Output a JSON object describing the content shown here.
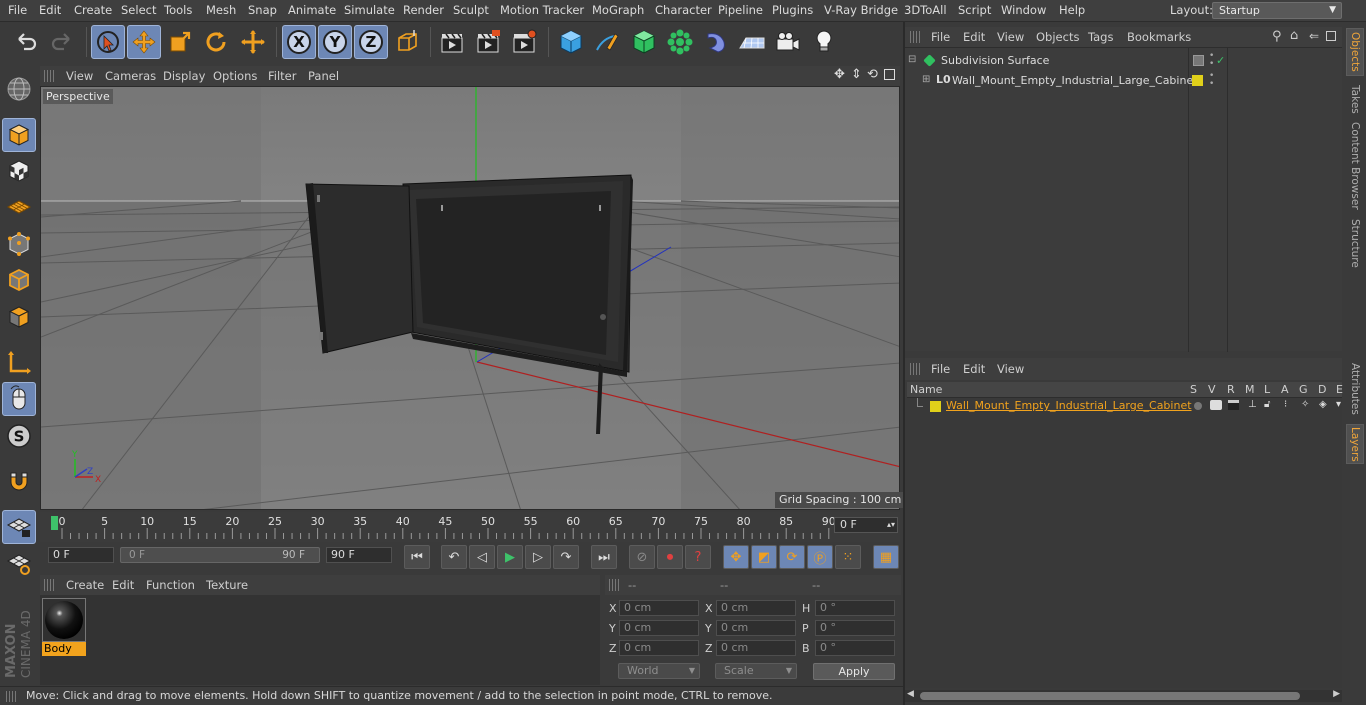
{
  "menubar": {
    "items": [
      "File",
      "Edit",
      "Create",
      "Select",
      "Tools",
      "Mesh",
      "Snap",
      "Animate",
      "Simulate",
      "Render",
      "Sculpt",
      "Motion Tracker",
      "MoGraph",
      "Character",
      "Pipeline",
      "Plugins",
      "V-Ray Bridge",
      "3DToAll",
      "Script",
      "Window",
      "Help"
    ],
    "layout_label": "Layout:",
    "layout_value": "Startup"
  },
  "viewport": {
    "menu": [
      "View",
      "Cameras",
      "Display",
      "Options",
      "Filter",
      "Panel"
    ],
    "label": "Perspective",
    "grid_spacing": "Grid Spacing : 100 cm",
    "axis_x": "X",
    "axis_y": "Y",
    "axis_z": "Z"
  },
  "timeline": {
    "ticks": [
      "0",
      "5",
      "10",
      "15",
      "20",
      "25",
      "30",
      "35",
      "40",
      "45",
      "50",
      "55",
      "60",
      "65",
      "70",
      "75",
      "80",
      "85",
      "90"
    ],
    "current_frame": "0 F"
  },
  "transport": {
    "start_field": "0 F",
    "range_start": "0 F",
    "range_end": "90 F",
    "end_field": "90 F"
  },
  "materials": {
    "menu": [
      "Create",
      "Edit",
      "Function",
      "Texture"
    ],
    "items": [
      {
        "name": "Body"
      }
    ]
  },
  "coordinates": {
    "headers": [
      "--",
      "--",
      "--"
    ],
    "rows": [
      {
        "l1": "X",
        "v1": "0 cm",
        "l2": "X",
        "v2": "0 cm",
        "l3": "H",
        "v3": "0 °"
      },
      {
        "l1": "Y",
        "v1": "0 cm",
        "l2": "Y",
        "v2": "0 cm",
        "l3": "P",
        "v3": "0 °"
      },
      {
        "l1": "Z",
        "v1": "0 cm",
        "l2": "Z",
        "v2": "0 cm",
        "l3": "B",
        "v3": "0 °"
      }
    ],
    "mode_world": "World",
    "mode_scale": "Scale",
    "apply": "Apply"
  },
  "status": "Move: Click and drag to move elements. Hold down SHIFT to quantize movement / add to the selection in point mode, CTRL to remove.",
  "objects": {
    "menu": [
      "File",
      "Edit",
      "View",
      "Objects",
      "Tags",
      "Bookmarks"
    ],
    "tree": [
      {
        "name": "Subdivision Surface"
      },
      {
        "name": "Wall_Mount_Empty_Industrial_Large_Cabinet"
      }
    ]
  },
  "layers": {
    "menu": [
      "File",
      "Edit",
      "View"
    ],
    "columns": [
      "Name",
      "S",
      "V",
      "R",
      "M",
      "L",
      "A",
      "G",
      "D",
      "E"
    ],
    "rows": [
      {
        "name": "Wall_Mount_Empty_Industrial_Large_Cabinet"
      }
    ]
  },
  "side_tabs": [
    "Objects",
    "Takes",
    "Content Browser",
    "Structure",
    "Attributes",
    "Layers"
  ],
  "brand": {
    "maxon": "MAXON",
    "cinema": "CINEMA 4D"
  },
  "colors": {
    "accent": "#f2a31d",
    "selected_tool": "#6d87b5",
    "layer_color": "#e0d01a",
    "axis_x": "#c02020",
    "axis_y": "#20b020",
    "axis_z": "#3040c0"
  }
}
